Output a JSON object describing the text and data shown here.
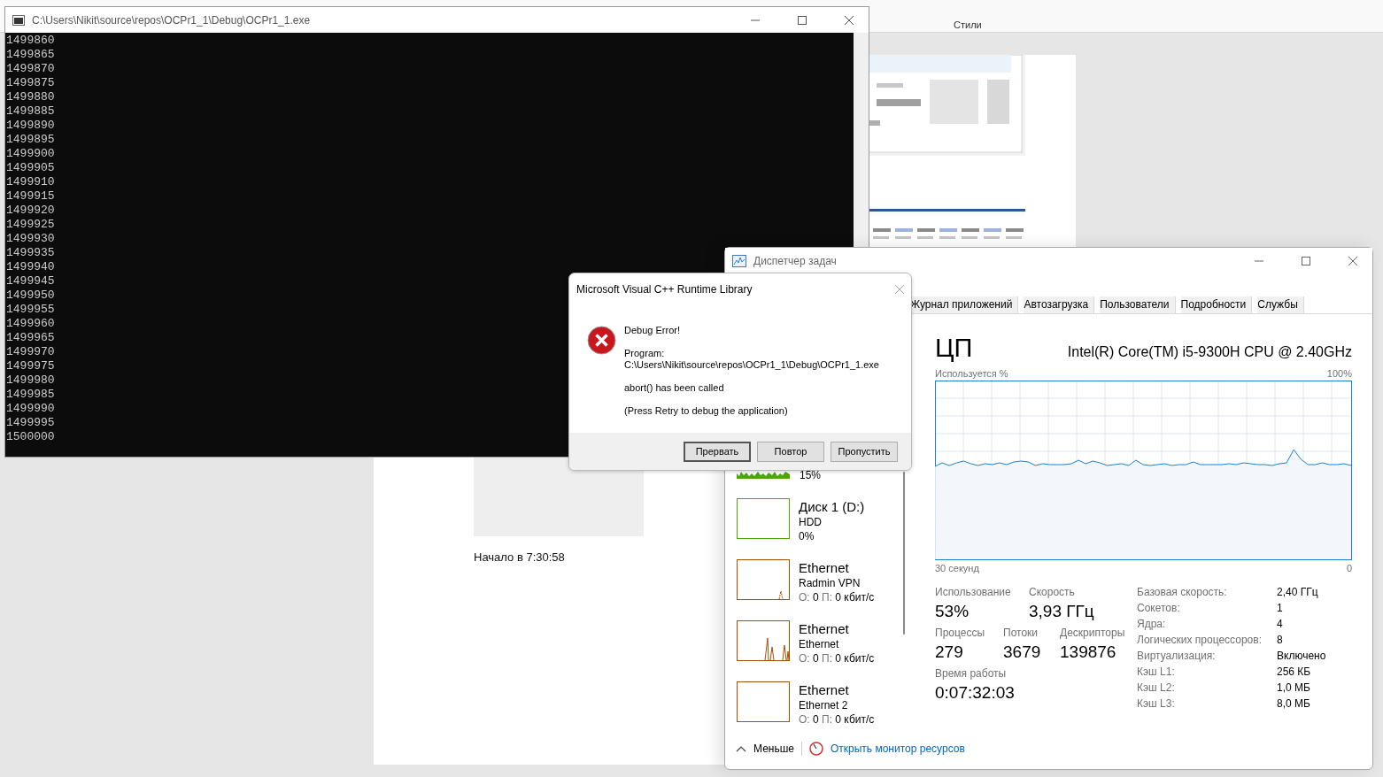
{
  "word": {
    "ribbon_group": "Стили",
    "start_time": "Начало в 7:30:58"
  },
  "console": {
    "title": "C:\\Users\\Nikit\\source\\repos\\OCPr1_1\\Debug\\OCPr1_1.exe",
    "lines": [
      "1499860",
      "1499865",
      "1499870",
      "1499875",
      "1499880",
      "1499885",
      "1499890",
      "1499895",
      "1499900",
      "1499905",
      "1499910",
      "1499915",
      "1499920",
      "1499925",
      "1499930",
      "1499935",
      "1499940",
      "1499945",
      "1499950",
      "1499955",
      "1499960",
      "1499965",
      "1499970",
      "1499975",
      "1499980",
      "1499985",
      "1499990",
      "1499995",
      "1500000"
    ]
  },
  "dialog": {
    "title": "Microsoft Visual C++ Runtime Library",
    "heading": "Debug Error!",
    "program_label": "Program:",
    "program_path": "C:\\Users\\Nikit\\source\\repos\\OCPr1_1\\Debug\\OCPr1_1.exe",
    "message": "abort() has been called",
    "hint": "(Press Retry to debug the application)",
    "buttons": [
      {
        "label": "Прервать",
        "selected": true
      },
      {
        "label": "Повтор",
        "selected": false
      },
      {
        "label": "Пропустить",
        "selected": false
      }
    ]
  },
  "task_manager": {
    "title": "Диспетчер задач",
    "tabs": [
      {
        "label": "Журнал приложений",
        "selected": false
      },
      {
        "label": "Автозагрузка",
        "selected": false
      },
      {
        "label": "Пользователи",
        "selected": false
      },
      {
        "label": "Подробности",
        "selected": false
      },
      {
        "label": "Службы",
        "selected": false
      }
    ],
    "resources": [
      {
        "kind": "partial",
        "value": "15%",
        "color": "#4da60c"
      },
      {
        "kind": "disk",
        "name": "Диск 1 (D:)",
        "subtitle": "HDD",
        "value": "0%",
        "color": "#4da60c"
      },
      {
        "kind": "network",
        "name": "Ethernet",
        "subtitle": "Radmin VPN",
        "send_label": "О:",
        "send_value": "0",
        "recv_label": "П:",
        "recv_value": "0 кбит/с",
        "color": "#a74f01"
      },
      {
        "kind": "network",
        "name": "Ethernet",
        "subtitle": "Ethernet",
        "send_label": "О:",
        "send_value": "0",
        "recv_label": "П:",
        "recv_value": "0 кбит/с",
        "color": "#a74f01"
      },
      {
        "kind": "network",
        "name": "Ethernet",
        "subtitle": "Ethernet 2",
        "send_label": "О:",
        "send_value": "0",
        "recv_label": "П:",
        "recv_value": "0 кбит/с",
        "color": "#a74f01"
      }
    ],
    "cpu": {
      "heading": "ЦП",
      "model": "Intel(R) Core(TM) i5-9300H CPU @ 2.40GHz",
      "axis_label": "Используется %",
      "axis_max": "100%",
      "time_label": "30 секунд",
      "axis_min": "0",
      "stats_rows": [
        [
          {
            "label": "Использование",
            "value": "53%"
          },
          {
            "label": "Скорость",
            "value": "3,93 ГГц"
          }
        ],
        [
          {
            "label": "Процессы",
            "value": "279"
          },
          {
            "label": "Потоки",
            "value": "3679"
          },
          {
            "label": "Дескрипторы",
            "value": "139876"
          }
        ],
        [
          {
            "label": "Время работы",
            "value": "0:07:32:03"
          }
        ]
      ],
      "specs": [
        {
          "label": "Базовая скорость:",
          "value": "2,40 ГГц"
        },
        {
          "label": "Сокетов:",
          "value": "1"
        },
        {
          "label": "Ядра:",
          "value": "4"
        },
        {
          "label": "Логических процессоров:",
          "value": "8"
        },
        {
          "label": "Виртуализация:",
          "value": "Включено"
        },
        {
          "label": "Кэш L1:",
          "value": "256 КБ"
        },
        {
          "label": "Кэш L2:",
          "value": "1,0 МБ"
        },
        {
          "label": "Кэш L3:",
          "value": "8,0 МБ"
        }
      ]
    },
    "footer": {
      "less": "Меньше",
      "link": "Открыть монитор ресурсов"
    }
  }
}
